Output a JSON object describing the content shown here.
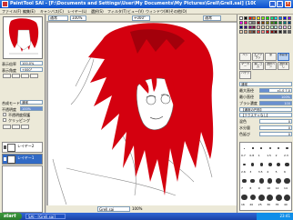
{
  "window": {
    "title": "PaintTool SAI - [F:\\Documents and Settings\\User\\My Documents\\My Pictures\\Grell\\Grell.sai] (100%)",
    "app_name": "SAI"
  },
  "menu": {
    "items": [
      "ファイル(F)",
      "編集(E)",
      "キャンバス(C)",
      "レイヤー(L)",
      "選択(S)",
      "フィルタ(T)",
      "ビュー(V)",
      "ウィンドウ(W)",
      "その他(O)"
    ]
  },
  "navigator": {
    "zoom_label": "表示倍率",
    "zoom_value": "100.0%",
    "angle_label": "表示角度",
    "angle_value": "+000°"
  },
  "layer_panel": {
    "mode_label": "合成モード",
    "mode_value": "通常",
    "opacity_label": "不透明度",
    "opacity_value": "100%",
    "protect_label": "不透明度保護",
    "clip_label": "クリッピング",
    "layers": [
      {
        "name": "レイヤー2",
        "selected": false
      },
      {
        "name": "レイヤー1",
        "selected": true
      }
    ]
  },
  "canvas_toolbar": {
    "select_value": "通常",
    "zoom_value": "100%",
    "angle_value": "+000°",
    "mode_value": "通常"
  },
  "canvas_status": {
    "filename": "Grell.sai",
    "zoom": "100%"
  },
  "tools": {
    "items": [
      "ペン",
      "エアブラシ",
      "筆",
      "水彩筆",
      "マーカー",
      "消しゴム",
      "選択ペン",
      "選択消し",
      "バケツ"
    ]
  },
  "brush_settings": {
    "mode_label": "通常",
    "size_label": "最大直径",
    "size_value": "x1.0  7.0",
    "min_label": "最小直径",
    "min_value": "100%",
    "density_label": "ブラシ濃度",
    "density_value": "100",
    "shape_label": "【通常の円形】",
    "texture_label": "【テクスチャなし】",
    "blend_label": "混色",
    "blend_value": "0",
    "water_label": "水分量",
    "water_value": "0",
    "persist_label": "色延び",
    "persist_value": "0",
    "sizes": [
      "0.7",
      "0.8",
      "1",
      "1.5",
      "2",
      "2.3",
      "2.6",
      "3",
      "3.5",
      "4",
      "5",
      "6",
      "7",
      "8",
      "9",
      "10",
      "12",
      "14",
      "16",
      "20",
      "25",
      "30",
      "35",
      "40"
    ]
  },
  "colors": {
    "accent": "#0a4fcf",
    "hair_red": "#d4000f",
    "palette": [
      "#ffffff",
      "#000000",
      "#ff0000",
      "#ff8000",
      "#ffff00",
      "#80ff00",
      "#00ff00",
      "#00ff80",
      "#00ffff",
      "#0080ff",
      "#0000ff",
      "#8000ff",
      "#ff00ff",
      "#ff0080",
      "#c0c0c0",
      "#808080",
      "#800000",
      "#804000",
      "#808000",
      "#408000",
      "#008000",
      "#008040",
      "#008080",
      "#004080",
      "#000080",
      "#400080",
      "#800080",
      "#800040",
      "#ffc0c0",
      "#ffe0c0",
      "#ffffc0",
      "#c0ffc0",
      "#c0ffff",
      "#c0c0ff",
      "#ffc0ff",
      "#e0e0e0",
      "#f0d0b0",
      "#d0a080",
      "#a06040",
      "#603020",
      "#ff4040",
      "#ff8080",
      "#d4000f",
      "#900000",
      "#400000",
      "#202020",
      "#404040",
      "#606060"
    ]
  },
  "taskbar": {
    "start_label": "start",
    "task_item": "SAI - [Grell.sai]",
    "clock": "23:41"
  }
}
